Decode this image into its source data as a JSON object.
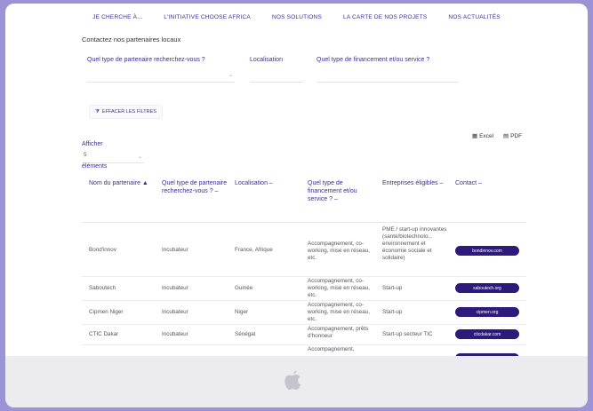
{
  "nav": [
    "JE CHERCHE À...",
    "L'INITIATIVE CHOOSE AFRICA",
    "NOS SOLUTIONS",
    "LA CARTE DE NOS PROJETS",
    "NOS ACTUALITÉS"
  ],
  "intro": "Contactez nos partenaires locaux",
  "filters": [
    {
      "label": "Quel type de partenaire recherchez-vous ?"
    },
    {
      "label": "Localisation"
    },
    {
      "label": "Quel type de financement et/ou service ?"
    }
  ],
  "clear_button": "EFFACER LES FILTRES",
  "export": {
    "excel": "Excel",
    "pdf": "PDF"
  },
  "length": {
    "label": "Afficher",
    "value": "5",
    "suffix": "éléments"
  },
  "columns": [
    "Nom du partenaire ▲",
    "Quel type de partenaire recherchez-vous ? –",
    "Localisation –",
    "Quel type de financement et/ou service ? –",
    "Entreprises éligibles –",
    "Contact –"
  ],
  "rows": [
    {
      "name": "Bond'innov",
      "type": "Incubateur",
      "loc": "France, Afrique",
      "service": "Accompagnement, co-working, mise en réseau, etc.",
      "eligible": "PME / start-up innovantes (santé/biotechnolo... environnement et économie sociale et solidaire)",
      "contact": "bondinnov.com"
    },
    {
      "name": "Saboutech",
      "type": "Incubateur",
      "loc": "Guinée",
      "service": "Accompagnement, co-working, mise en réseau, etc.",
      "eligible": "Start-up",
      "contact": "saboutech.org"
    },
    {
      "name": "Cipmen Niger",
      "type": "Incubateur",
      "loc": "Niger",
      "service": "Accompagnement, co-working, mise en réseau, etc.",
      "eligible": "Start-up",
      "contact": "cipmen.org"
    },
    {
      "name": "CTIC Dakar",
      "type": "Incubateur",
      "loc": "Sénégal",
      "service": "Accompagnement, prêts d'honneur",
      "eligible": "Start-up secteur TIC",
      "contact": "cticdakar.com"
    },
    {
      "name": "",
      "type": "",
      "loc": "",
      "service": "Accompagnement,",
      "eligible": "",
      "contact": ""
    }
  ]
}
